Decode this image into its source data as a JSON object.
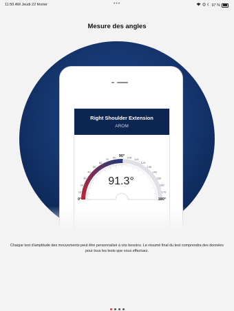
{
  "statusbar": {
    "time": "11:50 AM  Jeudi 22 février",
    "dots": "•••",
    "battery": "97 %"
  },
  "header": {
    "title": "Mesure des angles"
  },
  "card": {
    "title": "Right Shoulder Extension",
    "subtitle": "AROM",
    "value": "91.3°",
    "marker_label": "90°",
    "min_label": "0°",
    "max_label": "180°",
    "ticks": [
      "10",
      "20",
      "30",
      "40",
      "50",
      "60",
      "70",
      "80",
      "100",
      "110",
      "120",
      "130",
      "140",
      "150",
      "160",
      "170"
    ]
  },
  "gauge": {
    "value_deg": 91.3,
    "fill_color": "#c0263a",
    "fill_color_end": "#20397a",
    "track_color": "#e0e1e6"
  },
  "description": "Chaque test d'amplitude des mouvements peut être personnalisé à vos besoins. Le résumé final du test comprendra des données pour tous les tests que vous effectuez.",
  "pager": {
    "pages": 4,
    "active": 0
  }
}
